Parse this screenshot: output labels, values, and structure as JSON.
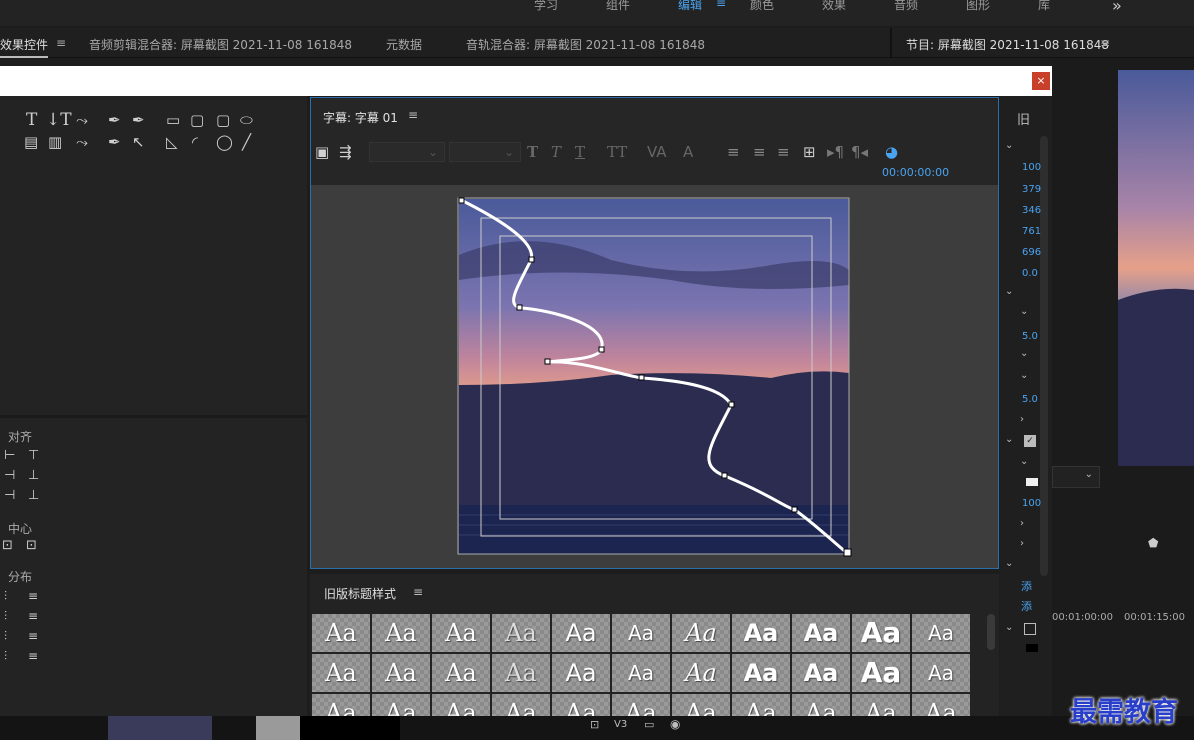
{
  "workspace_tabs": [
    {
      "label": "学习"
    },
    {
      "label": "组件"
    },
    {
      "label": "编辑"
    },
    {
      "label": "颜色"
    },
    {
      "label": "效果"
    },
    {
      "label": "音频"
    },
    {
      "label": "图形"
    },
    {
      "label": "库"
    }
  ],
  "panel_tabs": [
    {
      "label": "效果控件"
    },
    {
      "label": "音频剪辑混合器: 屏幕截图 2021-11-08 161848"
    },
    {
      "label": "元数据"
    },
    {
      "label": "音轨混合器: 屏幕截图 2021-11-08 161848"
    }
  ],
  "program_tab": "节目: 屏幕截图 2021-11-08 161848",
  "overflow": "»",
  "close_label": "×",
  "title_panel": {
    "title": "字幕: 字幕 01",
    "timecode": "00:00:00:00"
  },
  "align": {
    "label": "对齐",
    "center": "中心",
    "distribute": "分布"
  },
  "styles": {
    "title": "旧版标题样式",
    "sample": "Aa"
  },
  "right_values": [
    "100",
    "379",
    "346",
    "761",
    "696",
    "0.0",
    "5.0",
    "5.0",
    "100"
  ],
  "right_labels": {
    "old": "旧",
    "add1": "添",
    "add2": "添"
  },
  "timeline": {
    "t1": "00:01:00:00",
    "t2": "00:01:15:00",
    "track": "V3"
  },
  "watermark": "最需教育",
  "colors": {
    "accent": "#4aa3f0",
    "panel": "#232323",
    "close": "#c8402a"
  }
}
